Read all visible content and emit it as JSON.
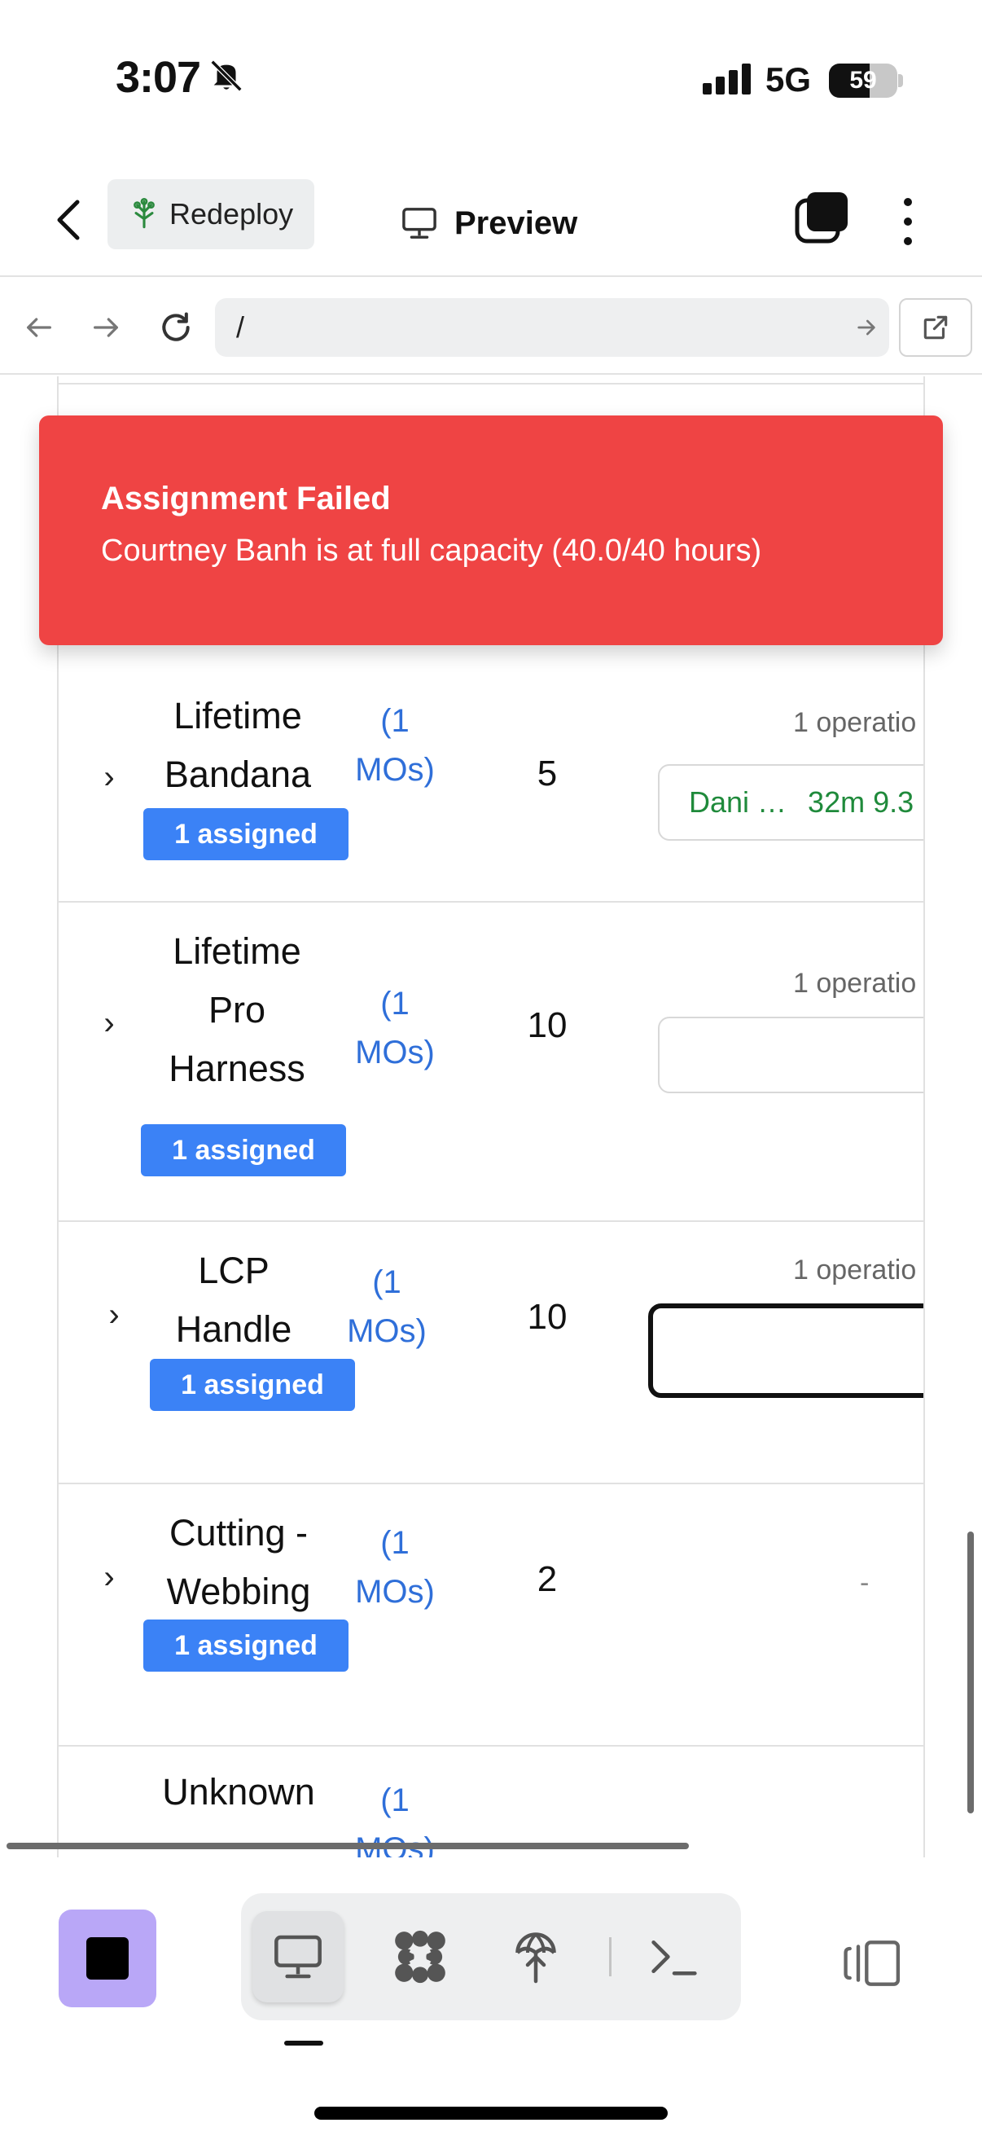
{
  "status_bar": {
    "time": "3:07",
    "network": "5G",
    "battery_percent": "59",
    "battery_level": 0.59
  },
  "header": {
    "redeploy_label": "Redeploy",
    "preview_label": "Preview"
  },
  "browser": {
    "url": "/"
  },
  "toast": {
    "title": "Assignment Failed",
    "message": "Courtney Banh is at full capacity (40.0/40 hours)"
  },
  "table": {
    "rows": [
      {
        "name_lines": [
          "Lifetime",
          "Bandana"
        ],
        "mos_lines": [
          "(1",
          "MOs)"
        ],
        "qty": "5",
        "assigned": "1 assigned",
        "operations": "1 operatio",
        "worker": "Dani …",
        "time": "32m 9.3"
      },
      {
        "name_lines": [
          "Lifetime",
          "Pro",
          "Harness"
        ],
        "mos_lines": [
          "(1",
          "MOs)"
        ],
        "qty": "10",
        "assigned": "1 assigned",
        "operations": "1 operatio"
      },
      {
        "name_lines": [
          "LCP",
          "Handle"
        ],
        "mos_lines": [
          "(1",
          "MOs)"
        ],
        "qty": "10",
        "assigned": "1 assigned",
        "operations": "1 operatio"
      },
      {
        "name_lines": [
          "Cutting -",
          "Webbing"
        ],
        "mos_lines": [
          "(1",
          "MOs)"
        ],
        "qty": "2",
        "assigned": "1 assigned",
        "operations_dash": "-"
      },
      {
        "name_lines": [
          "Unknown"
        ],
        "mos_lines": [
          "(1",
          "MOs)"
        ]
      }
    ]
  },
  "colors": {
    "toast_bg": "#ef4444",
    "badge_bg": "#3b82f6",
    "mos_link": "#2f6fd9",
    "worker_text": "#1f8a3b",
    "stop_button_bg": "#b9a7f7"
  },
  "icons": {
    "header": [
      "chevron-left-icon",
      "tree-icon",
      "monitor-icon",
      "tabs-icon",
      "more-vertical-icon"
    ],
    "browser": [
      "arrow-left-icon",
      "arrow-right-icon",
      "refresh-icon",
      "arrow-right-small-icon",
      "external-link-icon"
    ],
    "toolbar": [
      "stop-icon",
      "monitor-icon",
      "workflow-icon",
      "deploy-icon",
      "terminal-icon",
      "side-panel-icon"
    ]
  }
}
